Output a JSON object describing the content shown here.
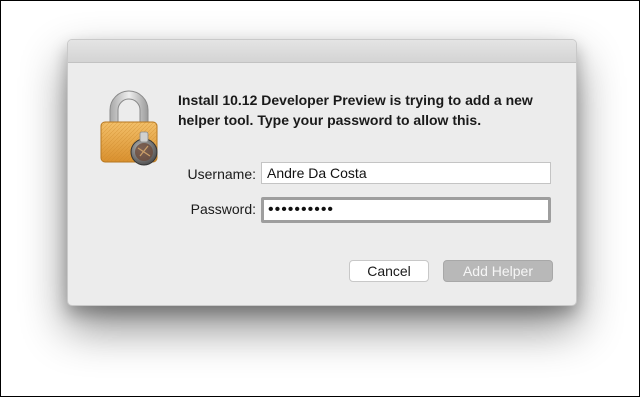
{
  "dialog": {
    "message": "Install 10.12 Developer Preview is trying to add a new helper tool. Type your password to allow this.",
    "username_label": "Username:",
    "username_value": "Andre Da Costa",
    "password_label": "Password:",
    "password_value": "••••••••••",
    "cancel_label": "Cancel",
    "confirm_label": "Add Helper",
    "icon": "lock-icon"
  },
  "colors": {
    "lock_body": "#e8a84a",
    "lock_shackle": "#c9c9c9",
    "dialog_bg": "#ececec",
    "disabled_button": "#b8b8b8"
  }
}
